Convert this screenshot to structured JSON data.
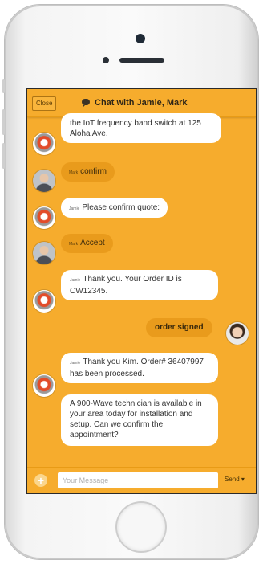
{
  "header": {
    "close_label": "Close",
    "title": "Chat with Jamie, Mark"
  },
  "messages": [
    {
      "sender": "",
      "text": "the IoT frequency band switch at 125 Aloha Ave.",
      "avatar": "bot-icon"
    },
    {
      "sender": "Mark",
      "text": "confirm",
      "avatar": "mark-photo"
    },
    {
      "sender": "Jamie",
      "text": "Please confirm quote:",
      "avatar": "bot-icon"
    },
    {
      "sender": "Mark",
      "text": "Accept",
      "avatar": "mark-photo"
    },
    {
      "sender": "Jamie",
      "text": "Thank you. Your Order ID is CW12345.",
      "avatar": "bot-icon"
    },
    {
      "sender": "",
      "text": "order signed",
      "avatar": "kim-photo"
    },
    {
      "sender": "Jamie",
      "text": "Thank you Kim. Order# 36407997 has been processed.",
      "avatar": "bot-icon"
    },
    {
      "sender": "",
      "text": "A 900-Wave technician is available in your area today for installation and setup. Can we confirm the appointment?",
      "avatar": ""
    }
  ],
  "composer": {
    "add_icon": "plus-icon",
    "placeholder": "Your Message",
    "send_label": "Send"
  },
  "colors": {
    "chat_background": "#f6ac2d",
    "outgoing_bubble": "#e99b1c",
    "incoming_bubble": "#ffffff"
  }
}
